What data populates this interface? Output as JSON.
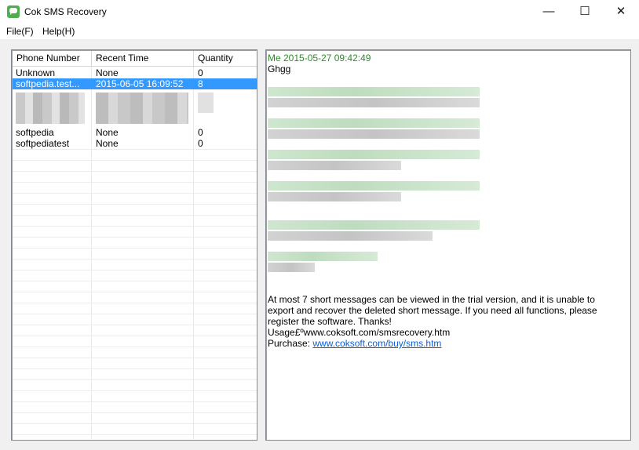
{
  "window": {
    "title": "Cok SMS Recovery",
    "controls": {
      "minimize": "—",
      "maximize": "☐",
      "close": "✕"
    }
  },
  "menu": {
    "file": "File(F)",
    "help": "Help(H)"
  },
  "contacts": {
    "columns": [
      "Phone Number",
      "Recent Time",
      "Quantity"
    ],
    "rows": [
      {
        "phone": "Unknown",
        "time": "None",
        "qty": "0",
        "selected": false
      },
      {
        "phone": "softpedia.test...",
        "time": "2015-06-05 16:09:52",
        "qty": "8",
        "selected": true
      },
      {
        "phone": "",
        "time": "",
        "qty": "",
        "redacted": true
      },
      {
        "phone": "softpedia",
        "time": "None",
        "qty": "0",
        "selected": false
      },
      {
        "phone": "softpediatest",
        "time": "None",
        "qty": "0",
        "selected": false
      }
    ]
  },
  "messages": {
    "header": "Me 2015-05-27 09:42:49",
    "first_body": "Ghgg",
    "trial_line1": "At most 7 short messages can be viewed in the trial version, and it is unable to",
    "trial_line2": "export and recover the deleted short message. If you need all functions, please",
    "trial_line3": "register the software. Thanks!",
    "usage": "Usage£ºwww.coksoft.com/smsrecovery.htm",
    "purchase_label": "Purchase: ",
    "purchase_link": "www.coksoft.com/buy/sms.htm"
  },
  "colors": {
    "selection": "#3399ff",
    "header_green": "#2e8b2e",
    "link": "#0b5ed7"
  }
}
